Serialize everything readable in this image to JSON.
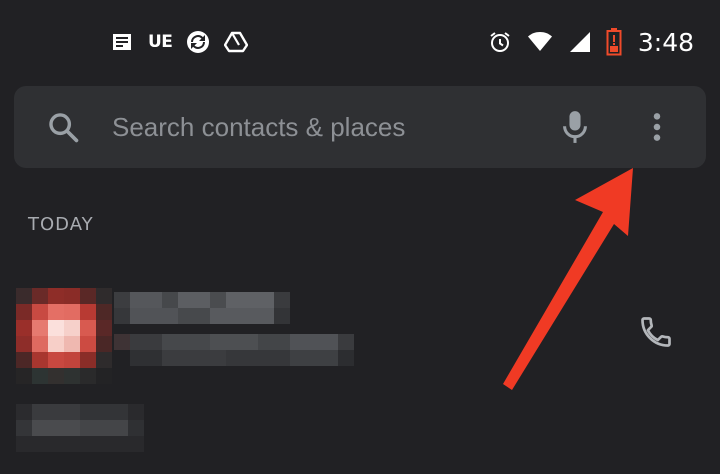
{
  "status_bar": {
    "notification_icons": [
      "news-icon",
      "ue-text-icon",
      "sync-icon",
      "drive-icon"
    ],
    "ue_label": "UE",
    "system_icons": [
      "alarm-icon",
      "wifi-icon",
      "cell-signal-icon",
      "battery-icon"
    ],
    "time": "3:48"
  },
  "search": {
    "placeholder": "Search contacts & places",
    "icons": [
      "search-icon",
      "mic-icon",
      "more-vert-icon"
    ]
  },
  "call_log": {
    "section_header": "TODAY",
    "items": [
      {
        "name": "",
        "detail": "",
        "action_icon": "phone-icon"
      }
    ]
  },
  "colors": {
    "background": "#212124",
    "search_bar": "#2f3033",
    "placeholder_text": "#8d9095",
    "header_text": "#a8abb0",
    "annotation_arrow": "#f03a24"
  }
}
